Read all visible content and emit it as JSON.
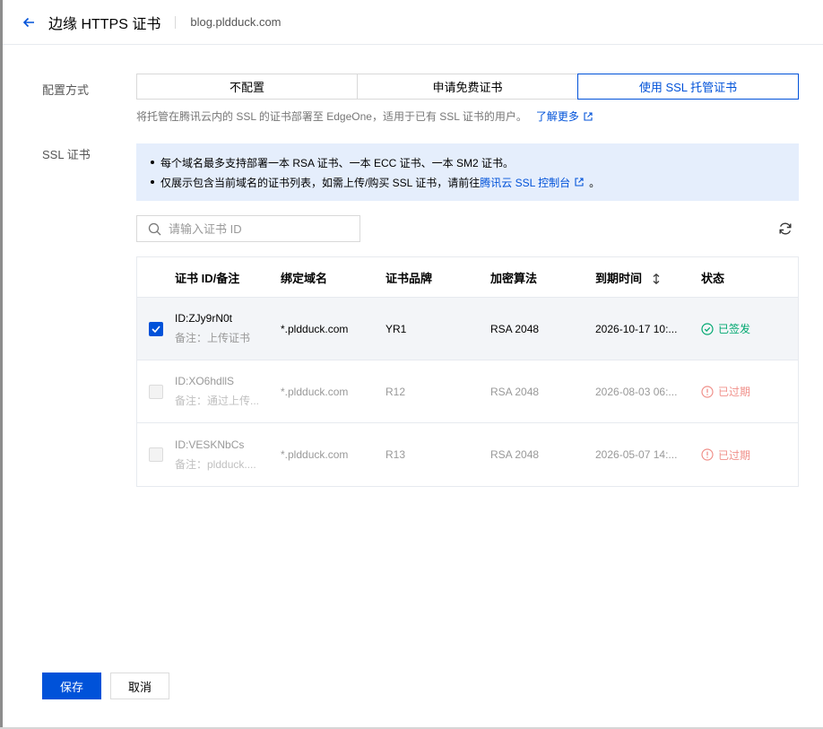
{
  "header": {
    "title": "边缘 HTTPS 证书",
    "domain": "blog.pldduck.com"
  },
  "config": {
    "label": "配置方式",
    "options": [
      "不配置",
      "申请免费证书",
      "使用 SSL 托管证书"
    ],
    "active_index": 2,
    "description": "将托管在腾讯云内的 SSL 的证书部署至 EdgeOne，适用于已有 SSL 证书的用户。",
    "learn_more": "了解更多"
  },
  "ssl": {
    "label": "SSL 证书",
    "notice_line1": "每个域名最多支持部署一本 RSA 证书、一本 ECC 证书、一本 SM2 证书。",
    "notice_line2_prefix": "仅展示包含当前域名的证书列表，如需上传/购买 SSL 证书，请前往 ",
    "notice_link": "腾讯云 SSL 控制台",
    "notice_line2_suffix": "。",
    "search_placeholder": "请输入证书 ID"
  },
  "table": {
    "columns": [
      "证书 ID/备注",
      "绑定域名",
      "证书品牌",
      "加密算法",
      "到期时间",
      "状态"
    ],
    "rows": [
      {
        "id": "ID:ZJy9rN0t",
        "remark": "备注：上传证书",
        "domain": "*.pldduck.com",
        "brand": "YR1",
        "algo": "RSA 2048",
        "expire": "2026-10-17 10:...",
        "status": "已签发"
      },
      {
        "id": "ID:XO6hdllS",
        "remark": "备注：通过上传...",
        "domain": "*.pldduck.com",
        "brand": "R12",
        "algo": "RSA 2048",
        "expire": "2026-08-03 06:...",
        "status": "已过期"
      },
      {
        "id": "ID:VESKNbCs",
        "remark": "备注：pldduck....",
        "domain": "*.pldduck.com",
        "brand": "R13",
        "algo": "RSA 2048",
        "expire": "2026-05-07 14:...",
        "status": "已过期"
      }
    ]
  },
  "footer": {
    "save": "保存",
    "cancel": "取消"
  },
  "colors": {
    "primary": "#0052d9",
    "success": "#00a870",
    "expired": "#f0908a",
    "notice_bg": "#e5eefc"
  }
}
